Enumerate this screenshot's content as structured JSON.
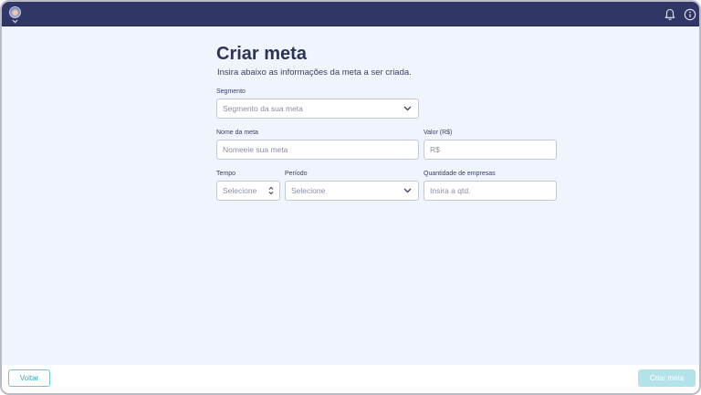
{
  "header": {
    "avatar_icon": "user-avatar",
    "notification_icon": "bell-icon",
    "help_icon": "info-icon"
  },
  "form": {
    "title": "Criar meta",
    "subtitle": "Insira abaixo as informações da meta a ser criada.",
    "segment": {
      "label": "Segmento",
      "placeholder": "Segmento da sua meta"
    },
    "name": {
      "label": "Nome da meta",
      "placeholder": "Nomeeie sua meta"
    },
    "value": {
      "label": "Valor (R$)",
      "placeholder": "R$"
    },
    "time": {
      "label": "Tempo",
      "placeholder": "Selecione"
    },
    "period": {
      "label": "Período",
      "placeholder": "Selecione"
    },
    "companies": {
      "label": "Quantidade de empresas",
      "placeholder": "Insira a qtd."
    }
  },
  "footer": {
    "back_label": "Voltar",
    "create_label": "Criar meta"
  },
  "colors": {
    "header_bg": "#303766",
    "page_bg": "#f0f4fd",
    "accent": "#3aa9b6",
    "disabled_button": "#b3e2e9"
  }
}
